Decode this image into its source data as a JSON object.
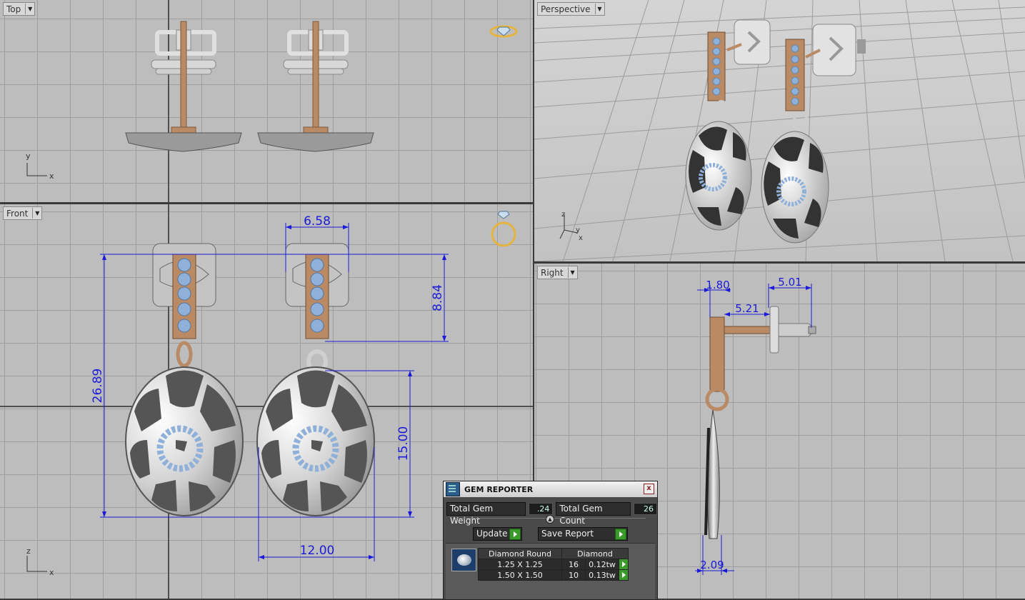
{
  "viewports": {
    "top": {
      "label": "Top"
    },
    "perspective": {
      "label": "Perspective"
    },
    "front": {
      "label": "Front"
    },
    "right": {
      "label": "Right"
    }
  },
  "axes": {
    "top": {
      "x": "x",
      "y": "y"
    },
    "front": {
      "x": "x",
      "z": "z"
    },
    "perspective": {
      "y": "y",
      "x": "x",
      "z": "z"
    }
  },
  "dimensions": {
    "front": {
      "width_top": "6.58",
      "height_bar": "8.84",
      "height_total": "26.89",
      "height_oval": "15.00",
      "width_oval": "12.00"
    },
    "right": {
      "d1": "1.80",
      "d2": "5.01",
      "d3": "5.21",
      "d4": "2.09"
    }
  },
  "gem_reporter": {
    "title": "GEM REPORTER",
    "close": "x",
    "total_weight_label": "Total Gem Weight",
    "total_weight_value": ".24",
    "total_count_label": "Total Gem Count",
    "total_count_value": "26",
    "update_label": "Update",
    "save_report_label": "Save Report",
    "table_header": [
      "Diamond Round",
      "Diamond"
    ],
    "rows": [
      {
        "size": "1.25 X 1.25",
        "count": "16",
        "weight": "0.12tw"
      },
      {
        "size": "1.50 X 1.50",
        "count": "10",
        "weight": "0.13tw"
      }
    ]
  },
  "colors": {
    "dimension": "#1a1ad8",
    "gold": "#b98a64",
    "metal": "#c9c9c9",
    "gem": "#8fb0d8",
    "enamel": "#555555",
    "accent_green": "#3c9a2c"
  }
}
